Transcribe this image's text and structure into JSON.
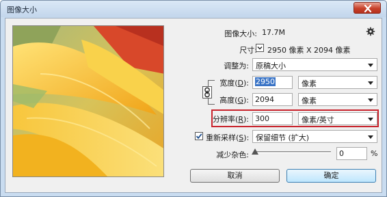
{
  "window": {
    "title": "图像大小"
  },
  "info": {
    "size_label": "图像大小:",
    "size_value": "17.7M",
    "dimensions_label": "尺寸:",
    "dimensions_value": "2950 像素  X  2094 像素"
  },
  "fit": {
    "label": "调整为:",
    "value": "原稿大小"
  },
  "width": {
    "label_pre": "宽度(",
    "key": "D",
    "label_post": "):",
    "value": "2950",
    "unit": "像素"
  },
  "height": {
    "label_pre": "高度(",
    "key": "G",
    "label_post": "):",
    "value": "2094",
    "unit": "像素"
  },
  "resolution": {
    "label_pre": "分辨率(",
    "key": "R",
    "label_post": "):",
    "value": "300",
    "unit": "像素/英寸"
  },
  "resample": {
    "checked": true,
    "label_pre": "重新采样(",
    "key": "S",
    "label_post": "):",
    "value": "保留细节 (扩大)"
  },
  "noise": {
    "label": "减少杂色:",
    "value": "0",
    "unit": "%",
    "slider_level": 0
  },
  "buttons": {
    "cancel": "取消",
    "ok": "确定"
  },
  "colors": {
    "accent": "#3a74c6",
    "highlight": "#c8232c",
    "close": "#c8412b"
  },
  "icons": {
    "close": "close-icon",
    "settings": "gear-icon",
    "link": "chain-link-icon",
    "preview": "yellow-flower-petals"
  }
}
